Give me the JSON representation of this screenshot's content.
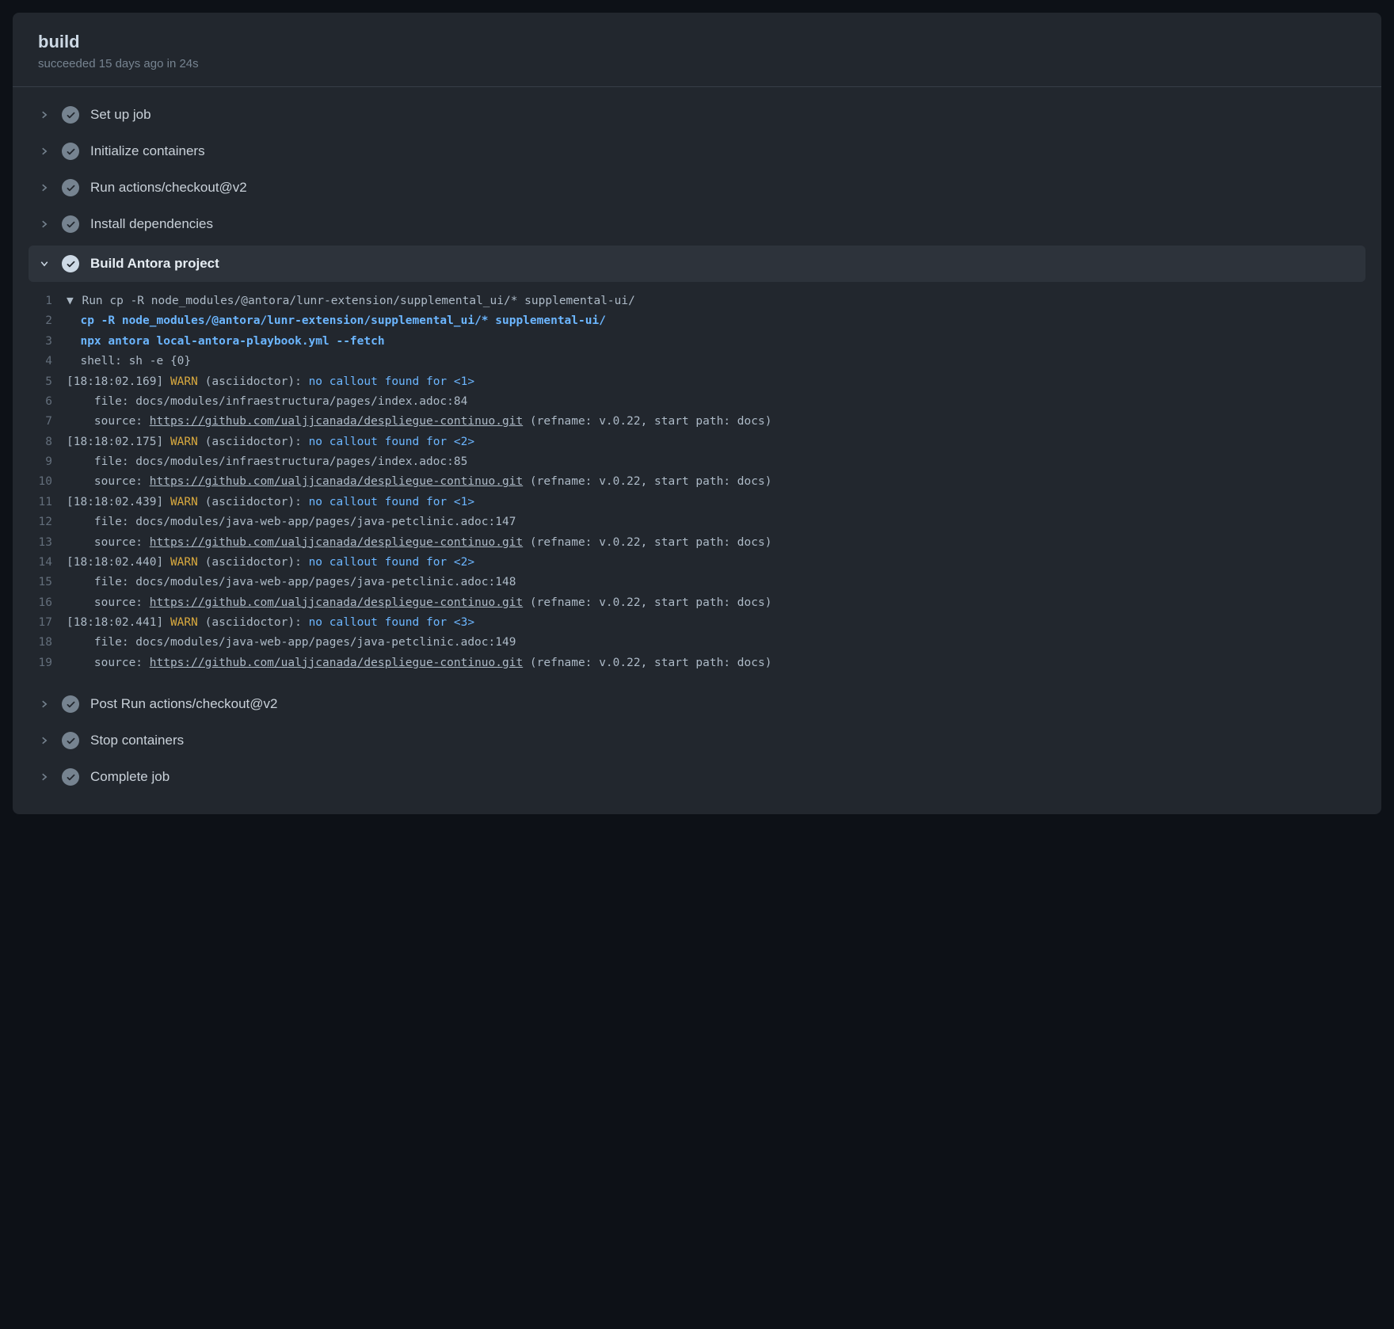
{
  "header": {
    "title": "build",
    "subtitle": "succeeded 15 days ago in 24s"
  },
  "steps": {
    "setup": "Set up job",
    "init": "Initialize containers",
    "checkout": "Run actions/checkout@v2",
    "deps": "Install dependencies",
    "build": "Build Antora project",
    "postcheckout": "Post Run actions/checkout@v2",
    "stop": "Stop containers",
    "complete": "Complete job"
  },
  "log": {
    "l1_pre": "Run ",
    "l1_cmd": "cp -R node_modules/@antora/lunr-extension/supplemental_ui/* supplemental-ui/",
    "l2": "cp -R node_modules/@antora/lunr-extension/supplemental_ui/* supplemental-ui/",
    "l3": "npx antora local-antora-playbook.yml --fetch",
    "l4": "shell: sh -e {0}",
    "l5_ts": "[18:18:02.169]",
    "l5_warn": "WARN",
    "l5_paren": "(asciidoctor):",
    "l5_msg": "no callout found for <1>",
    "l6": "    file: docs/modules/infraestructura/pages/index.adoc:84",
    "l7_pre": "    source: ",
    "l7_url": "https://github.com/ualjjcanada/despliegue-continuo.git",
    "l7_post": " (refname: v.0.22, start path: docs)",
    "l8_ts": "[18:18:02.175]",
    "l8_msg": "no callout found for <2>",
    "l9": "    file: docs/modules/infraestructura/pages/index.adoc:85",
    "l10_pre": "    source: ",
    "l10_url": "https://github.com/ualjjcanada/despliegue-continuo.git",
    "l10_post": " (refname: v.0.22, start path: docs)",
    "l11_ts": "[18:18:02.439]",
    "l11_msg": "no callout found for <1>",
    "l12": "    file: docs/modules/java-web-app/pages/java-petclinic.adoc:147",
    "l13_pre": "    source: ",
    "l13_url": "https://github.com/ualjjcanada/despliegue-continuo.git",
    "l13_post": " (refname: v.0.22, start path: docs)",
    "l14_ts": "[18:18:02.440]",
    "l14_msg": "no callout found for <2>",
    "l15": "    file: docs/modules/java-web-app/pages/java-petclinic.adoc:148",
    "l16_pre": "    source: ",
    "l16_url": "https://github.com/ualjjcanada/despliegue-continuo.git",
    "l16_post": " (refname: v.0.22, start path: docs)",
    "l17_ts": "[18:18:02.441]",
    "l17_msg": "no callout found for <3>",
    "l18": "    file: docs/modules/java-web-app/pages/java-petclinic.adoc:149",
    "l19_pre": "    source: ",
    "l19_url": "https://github.com/ualjjcanada/despliegue-continuo.git",
    "l19_post": " (refname: v.0.22, start path: docs)"
  }
}
